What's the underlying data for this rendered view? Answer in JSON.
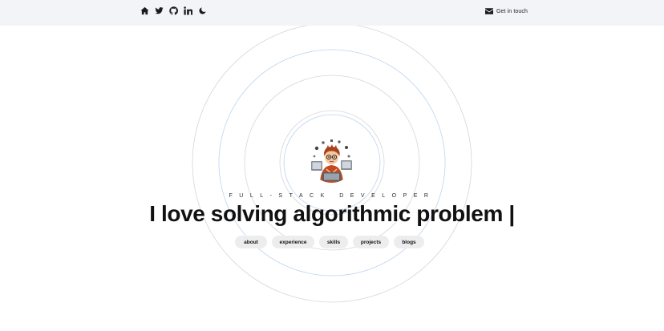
{
  "header": {
    "nav_icons": [
      "home-icon",
      "twitter-icon",
      "github-icon",
      "linkedin-icon",
      "moon-icon"
    ],
    "contact_label": "Get in touch",
    "contact_icon": "mail-icon"
  },
  "hero": {
    "subtitle": "FULL-STACK DEVELOPER",
    "headline": "I love solving algorithmic problem |"
  },
  "nav_pills": [
    {
      "label": "about"
    },
    {
      "label": "experience"
    },
    {
      "label": "skills"
    },
    {
      "label": "projects"
    },
    {
      "label": "blogs"
    }
  ],
  "colors": {
    "header_bg": "#f2f4f7",
    "ring_gray": "#d6d6d6",
    "ring_blue": "#bcd3ef",
    "pill_bg": "#ededed",
    "text": "#111111"
  }
}
